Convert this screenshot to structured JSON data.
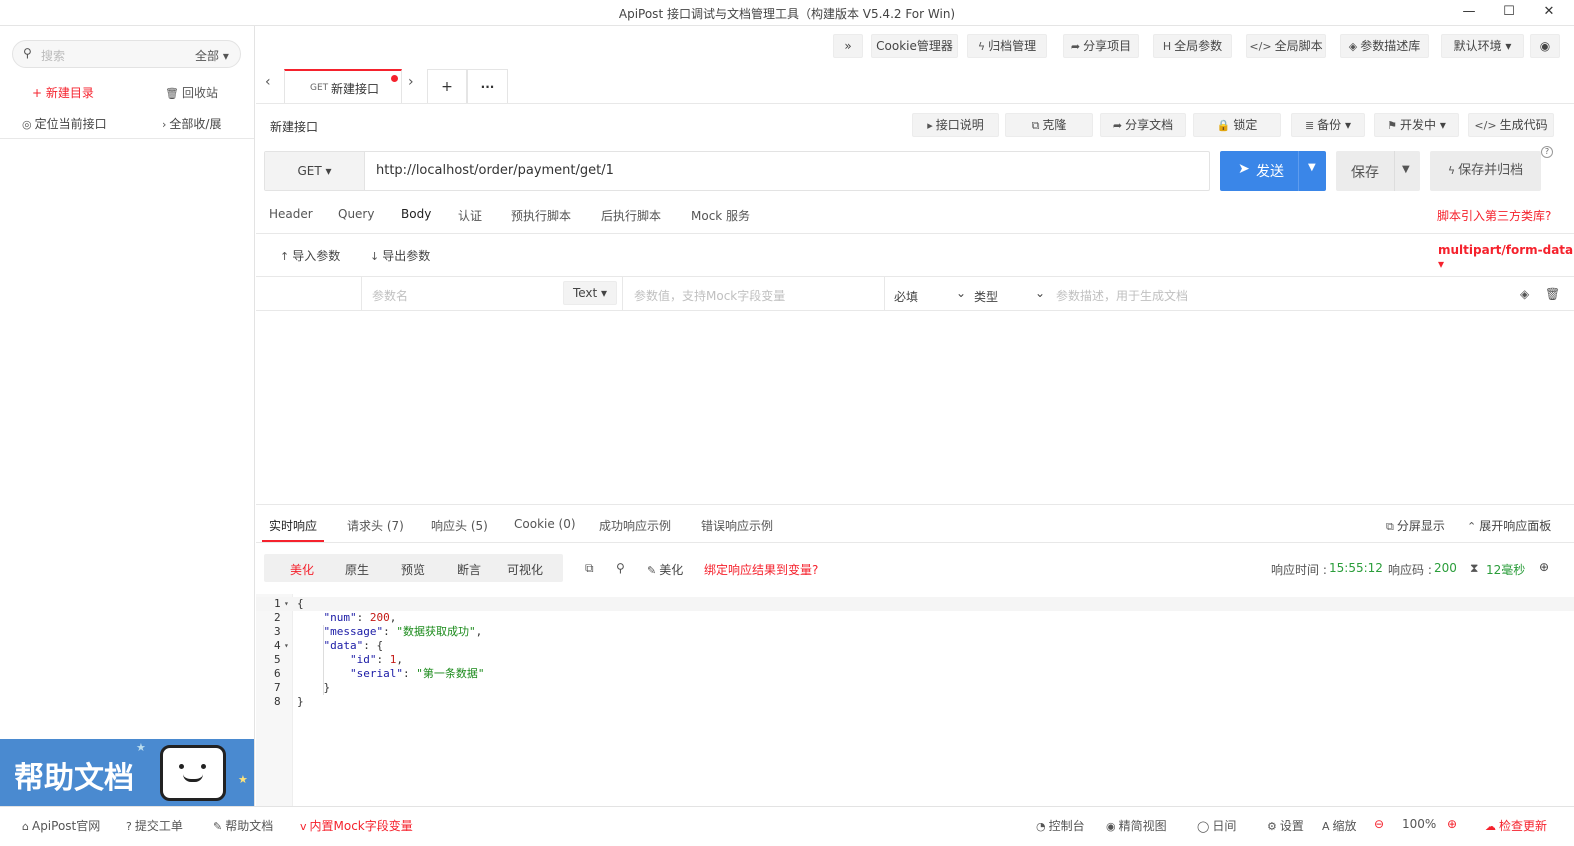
{
  "window": {
    "title": "ApiPost 接口调试与文档管理工具（构建版本 V5.4.2 For Win)",
    "min": "—",
    "max": "☐",
    "close": "✕"
  },
  "sidebar": {
    "search_placeholder": "搜索",
    "filter": "全部",
    "new_dir": "+ 新建目录",
    "recycle": "回收站",
    "locate": "定位当前接口",
    "expand": "全部收/展",
    "help_banner": "帮助文档"
  },
  "toptoolbar": {
    "more": "»",
    "cookie": "Cookie管理器",
    "archive": "归档管理",
    "share_project": "分享项目",
    "global_params": "全局参数",
    "global_script": "全局脚本",
    "param_lib": "参数描述库",
    "env": "默认环境"
  },
  "tabs": {
    "active_method": "GET",
    "active_name": "新建接口",
    "add": "+",
    "more": "···"
  },
  "api": {
    "name": "新建接口",
    "actions": {
      "doc": "接口说明",
      "clone": "克隆",
      "share_doc": "分享文档",
      "lock": "锁定",
      "backup": "备份",
      "status": "开发中",
      "gen_code": "生成代码"
    },
    "method": "GET",
    "url": "http://localhost/order/payment/get/1",
    "send": "发送",
    "save": "保存",
    "save_archive": "保存并归档",
    "help": "?"
  },
  "request_tabs": [
    "Header",
    "Query",
    "Body",
    "认证",
    "预执行脚本",
    "后执行脚本",
    "Mock 服务"
  ],
  "request_active": "Body",
  "script_link": "脚本引入第三方类库?",
  "body": {
    "import": "导入参数",
    "export": "导出参数",
    "content_type": "multipart/form-data",
    "row": {
      "name_ph": "参数名",
      "type": "Text",
      "value_ph": "参数值，支持Mock字段变量",
      "required": "必填",
      "kind": "类型",
      "desc_ph": "参数描述，用于生成文档"
    }
  },
  "response_tabs": [
    "实时响应",
    "请求头 (7)",
    "响应头 (5)",
    "Cookie (0)",
    "成功响应示例",
    "错误响应示例"
  ],
  "response_active": "实时响应",
  "split_view": "分屏显示",
  "expand_panel": "展开响应面板",
  "view_tabs": [
    "美化",
    "原生",
    "预览",
    "断言",
    "可视化"
  ],
  "view_active": "美化",
  "beautify": "美化",
  "bind_var": "绑定响应结果到变量?",
  "resp_info": {
    "time_label": "响应时间 :",
    "time": "15:55:12",
    "code_label": "响应码 :",
    "code": "200",
    "duration": "12毫秒"
  },
  "code_lines": [
    "1",
    "2",
    "3",
    "4",
    "5",
    "6",
    "7",
    "8"
  ],
  "json_text": {
    "l1": "{",
    "k_num": "\"num\"",
    "v_num": "200",
    "k_msg": "\"message\"",
    "v_msg": "\"数据获取成功\"",
    "k_data": "\"data\"",
    "l4b": ": {",
    "k_id": "\"id\"",
    "v_id": "1",
    "k_serial": "\"serial\"",
    "v_serial": "\"第一条数据\"",
    "l7": "}",
    "l8": "}"
  },
  "footer": {
    "site": "ApiPost官网",
    "ticket": "提交工单",
    "help": "帮助文档",
    "mock": "内置Mock字段变量",
    "console": "控制台",
    "compact": "精简视图",
    "day": "日间",
    "settings": "设置",
    "zoom": "缩放",
    "zoom_val": "100%",
    "update": "检查更新"
  },
  "colors": {
    "accent": "#f5222d",
    "primary": "#3a86e8",
    "green": "#2a9d3a"
  }
}
